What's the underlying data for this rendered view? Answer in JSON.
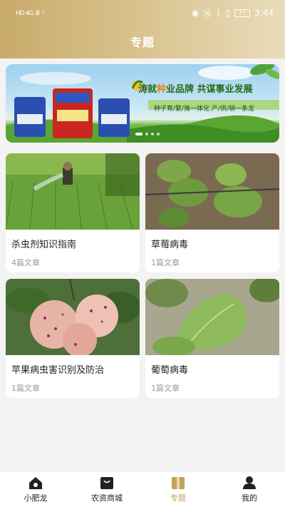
{
  "status_bar": {
    "time": "3:44",
    "battery": "77",
    "left_icons": "HD 4G .ıll ⌔"
  },
  "page_title": "专题",
  "banner": {
    "slogan_brand": "涛就",
    "slogan_highlight": "种",
    "slogan_rest": "业品牌 共谋事业发展",
    "tagline": "种子育/繁/推一体化 产/供/销一条龙",
    "product_label": "沧玉76",
    "slide_count": 4,
    "active_slide": 1
  },
  "cards": [
    {
      "title": "杀虫剂知识指南",
      "count": "4篇文章"
    },
    {
      "title": "草莓病毒",
      "count": "1篇文章"
    },
    {
      "title": "苹果病虫害识别及防治",
      "count": "1篇文章"
    },
    {
      "title": "葡萄病毒",
      "count": "1篇文章"
    }
  ],
  "nav": {
    "items": [
      {
        "label": "小肥龙",
        "icon": "home-icon"
      },
      {
        "label": "农资商城",
        "icon": "shopping-bag-icon"
      },
      {
        "label": "专题",
        "icon": "topic-book-icon"
      },
      {
        "label": "我的",
        "icon": "user-icon"
      }
    ],
    "active_index": 2
  },
  "colors": {
    "accent": "#c2a25c",
    "header_start": "#c8ab6b",
    "header_end": "#e9dcbc"
  }
}
